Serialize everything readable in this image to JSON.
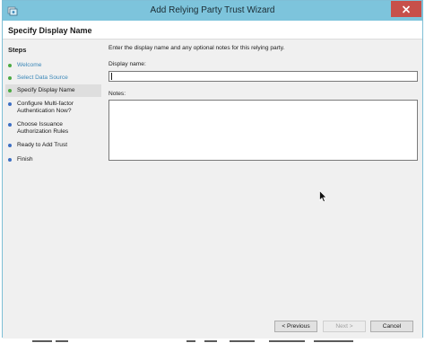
{
  "window": {
    "title": "Add Relying Party Trust Wizard",
    "app_icon": "relying-party-wizard-icon",
    "close_icon": "close-icon"
  },
  "header": {
    "page_title": "Specify Display Name"
  },
  "sidebar": {
    "heading": "Steps",
    "steps": [
      {
        "label": "Welcome",
        "state": "done"
      },
      {
        "label": "Select Data Source",
        "state": "done"
      },
      {
        "label": "Specify Display Name",
        "state": "current"
      },
      {
        "label": "Configure Multi-factor Authentication Now?",
        "label_line1": "Configure Multi-factor",
        "label_line2": "Authentication Now?",
        "state": "pending"
      },
      {
        "label": "Choose Issuance Authorization Rules",
        "label_line1": "Choose Issuance",
        "label_line2": "Authorization Rules",
        "state": "pending"
      },
      {
        "label": "Ready to Add Trust",
        "state": "pending"
      },
      {
        "label": "Finish",
        "state": "pending"
      }
    ]
  },
  "main": {
    "instruction": "Enter the display name and any optional notes for this relying party.",
    "display_name_label": "Display name:",
    "display_name_value": "",
    "notes_label": "Notes:",
    "notes_value": ""
  },
  "footer": {
    "previous_label": "< Previous",
    "next_label": "Next >",
    "next_enabled": false,
    "cancel_label": "Cancel"
  },
  "colors": {
    "titlebar": "#7dc4dc",
    "close_button": "#c7504a",
    "step_done_dot": "#4caa44",
    "step_pending_dot": "#3d6fc2",
    "step_done_text": "#3a87b8"
  }
}
